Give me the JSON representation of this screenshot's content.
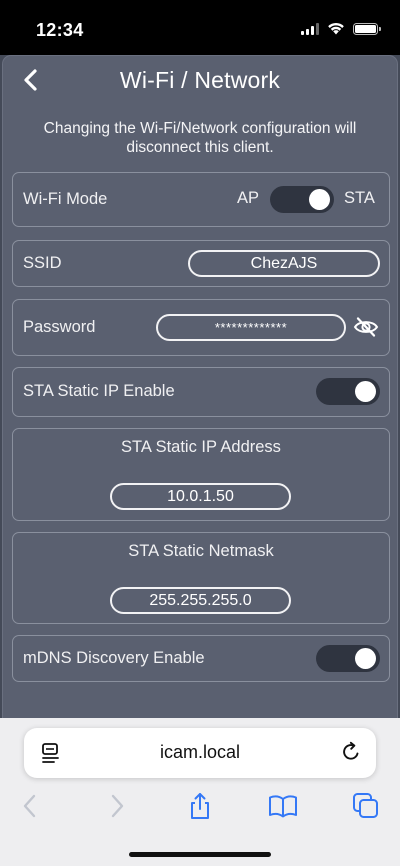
{
  "status_bar": {
    "time": "12:34"
  },
  "page": {
    "title": "Wi-Fi / Network",
    "warning": "Changing the Wi-Fi/Network configuration will disconnect this client.",
    "wifi_mode": {
      "label": "Wi-Fi Mode",
      "left_option": "AP",
      "right_option": "STA",
      "selected": "STA"
    },
    "ssid": {
      "label": "SSID",
      "value": "ChezAJS"
    },
    "password": {
      "label": "Password",
      "value": "*************"
    },
    "sta_static_ip_enable": {
      "label": "STA Static IP Enable",
      "enabled": true
    },
    "sta_static_ip_address": {
      "label": "STA Static IP Address",
      "value": "10.0.1.50"
    },
    "sta_static_netmask": {
      "label": "STA Static Netmask",
      "value": "255.255.255.0"
    },
    "mdns_discovery_enable": {
      "label": "mDNS Discovery Enable",
      "enabled": true
    }
  },
  "browser": {
    "url": "icam.local"
  },
  "colors": {
    "panel": "#5a6070",
    "toggle_track": "#2f3440",
    "browser_accent": "#3478f6"
  }
}
